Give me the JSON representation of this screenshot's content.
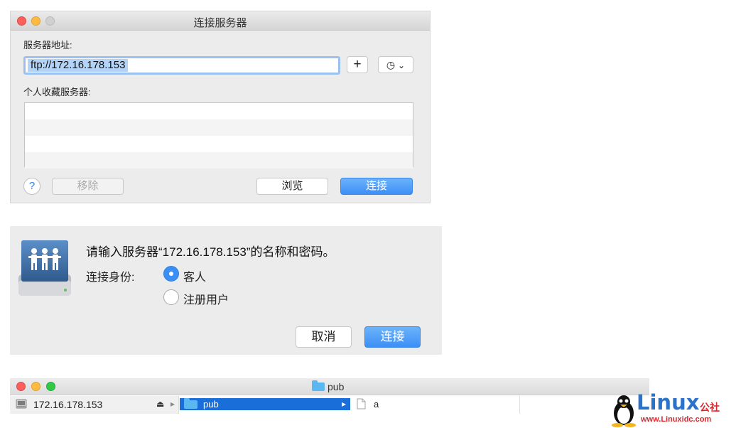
{
  "connect_window": {
    "title": "连接服务器",
    "server_address_label": "服务器地址:",
    "server_address_value": "ftp://172.16.178.153",
    "add_button_glyph": "+",
    "recent_glyph": "◷",
    "recent_chevron": "⌄",
    "favorites_label": "个人收藏服务器:",
    "help_glyph": "?",
    "remove_button": "移除",
    "browse_button": "浏览",
    "connect_button": "连接"
  },
  "auth_dialog": {
    "message": "请输入服务器“172.16.178.153”的名称和密码。",
    "connect_as_label": "连接身份:",
    "options": [
      "客人",
      "注册用户"
    ],
    "selected_option": "客人",
    "cancel_button": "取消",
    "connect_button": "连接"
  },
  "finder_window": {
    "title": "pub",
    "sidebar_server": "172.16.178.153",
    "eject_glyph": "⏏",
    "expand_glyph": "▸",
    "selected_folder": "pub",
    "file_name": "a"
  },
  "watermark": {
    "brand": "Linux",
    "brand_suffix": "公社",
    "url": "www.Linuxidc.com"
  },
  "colors": {
    "accent_blue": "#3d8ff7",
    "selection_blue": "#1a6ed9",
    "close_red": "#fc605c",
    "minimize_yellow": "#fdbc40",
    "zoom_green": "#34c84a",
    "folder_blue": "#5ab7ef",
    "watermark_blue": "#2b73c9",
    "watermark_red": "#d9272e"
  }
}
